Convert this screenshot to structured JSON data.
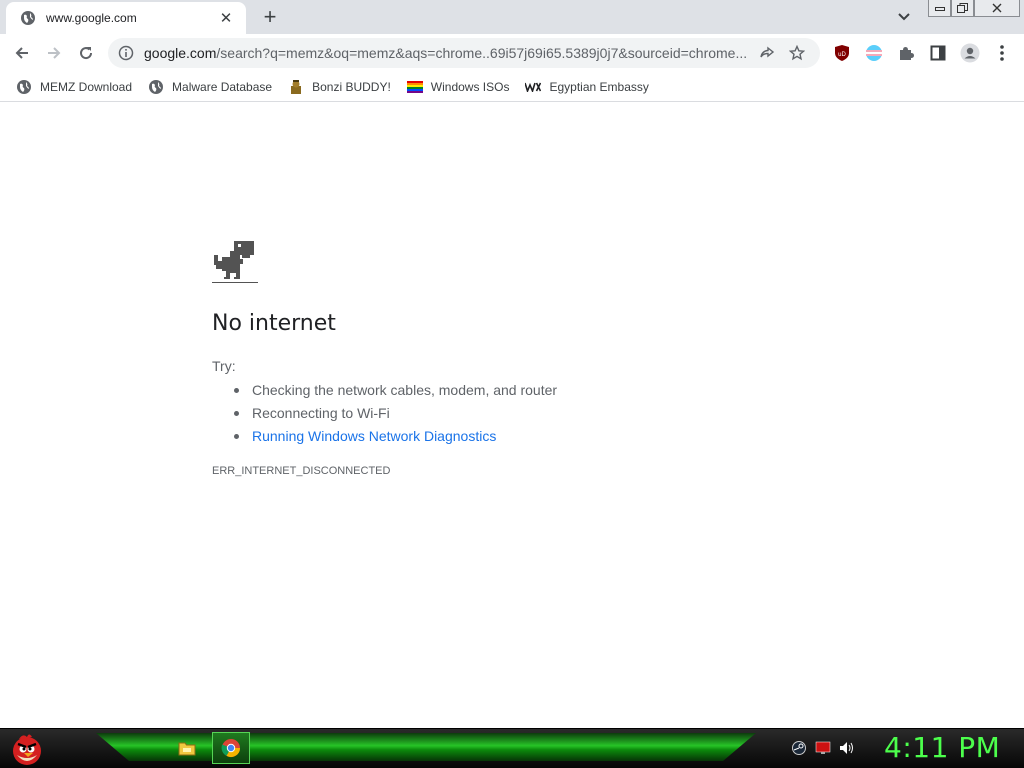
{
  "browser": {
    "tab": {
      "title": "www.google.com",
      "favicon": "globe-icon",
      "close_label": "✕"
    },
    "new_tab_label": "+",
    "address_bar": {
      "host": "google.com",
      "path": "/search?q=memz&oq=memz&aqs=chrome..69i57j69i65.5389j0j7&sourceid=chrome..."
    },
    "bookmarks": [
      {
        "label": "MEMZ Download",
        "icon": "globe-icon"
      },
      {
        "label": "Malware Database",
        "icon": "globe-icon"
      },
      {
        "label": "Bonzi BUDDY!",
        "icon": "bonzi-icon"
      },
      {
        "label": "Windows ISOs",
        "icon": "rainbow-flag-icon"
      },
      {
        "label": "Egyptian Embassy",
        "icon": "wix-icon"
      }
    ]
  },
  "error_page": {
    "title": "No internet",
    "try_label": "Try:",
    "suggestions": [
      "Checking the network cables, modem, and router",
      "Reconnecting to Wi-Fi",
      "Running Windows Network Diagnostics"
    ],
    "error_code": "ERR_INTERNET_DISCONNECTED"
  },
  "taskbar": {
    "clock": "4:11 PM"
  },
  "colors": {
    "link": "#1a73e8",
    "clock": "#4cff4c",
    "taskbar_glow": "#27c427"
  }
}
